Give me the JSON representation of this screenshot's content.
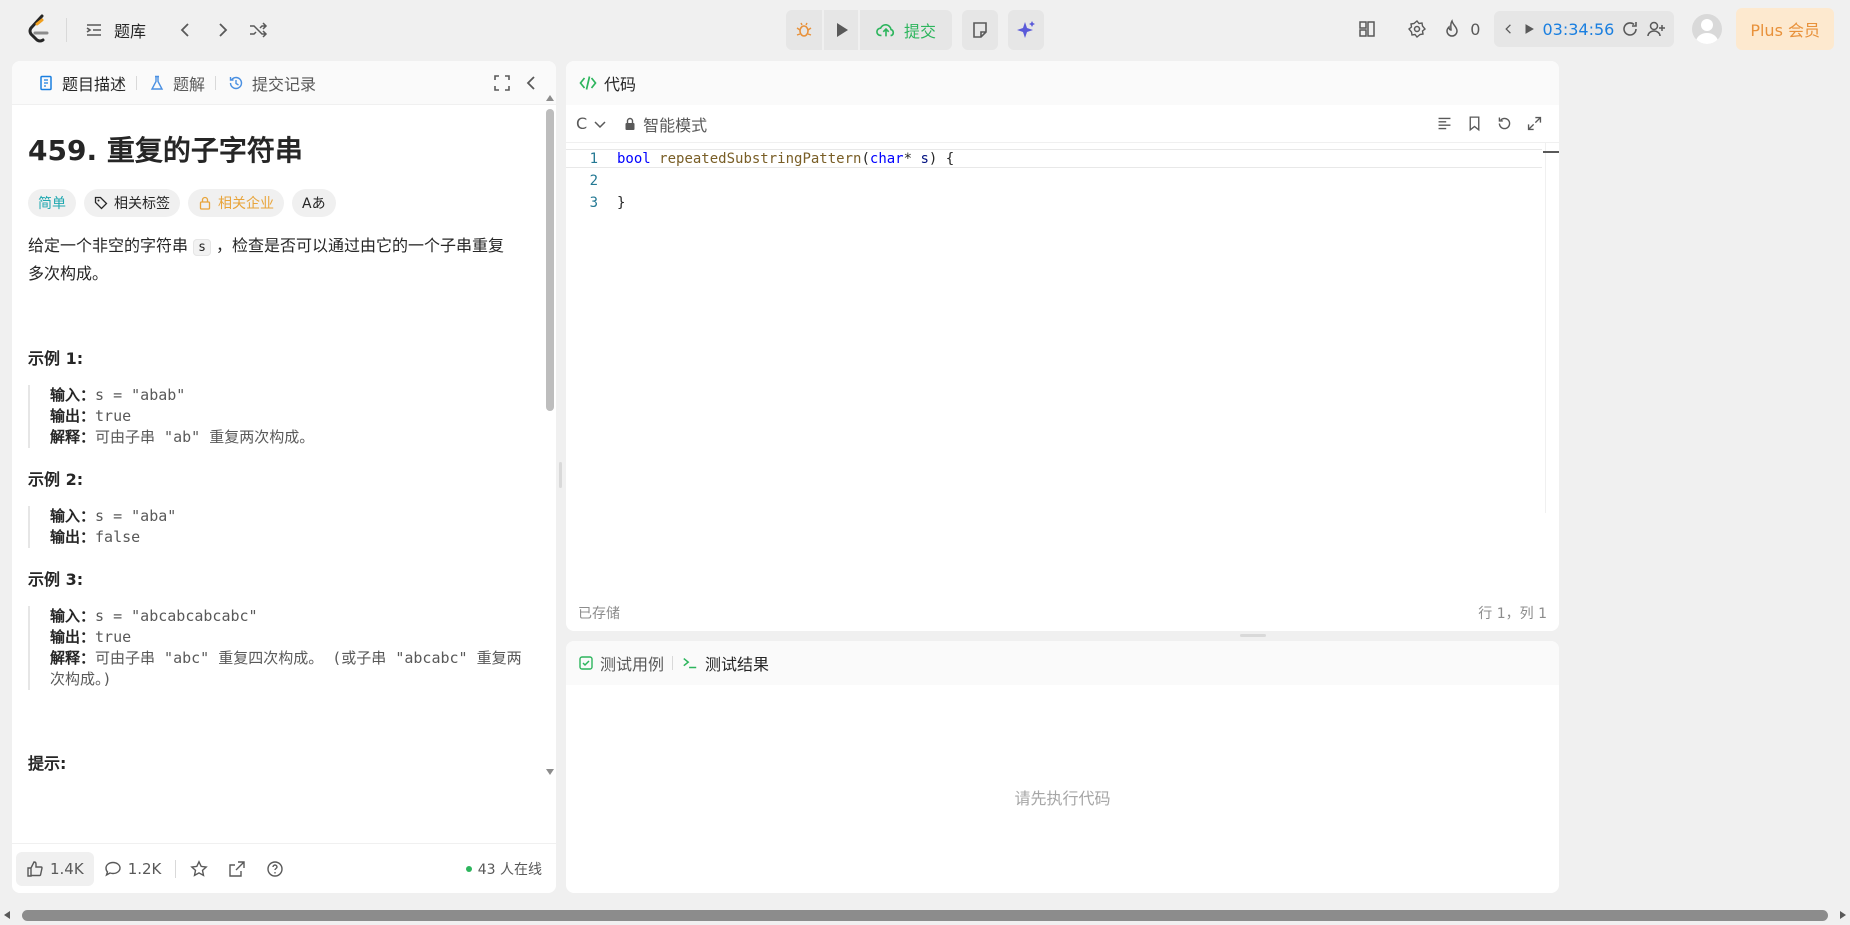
{
  "topbar": {
    "problemset_label": "题库",
    "submit_label": "提交",
    "fire_count": "0",
    "timer": "03:34:56",
    "plus_label": "Plus 会员"
  },
  "left_tabs": [
    {
      "label": "题目描述"
    },
    {
      "label": "题解"
    },
    {
      "label": "提交记录"
    }
  ],
  "problem": {
    "title": "459. 重复的子字符串",
    "tags": {
      "difficulty": "简单",
      "related_tags": "相关标签",
      "related_companies": "相关企业",
      "translate_icon": "Aあ"
    },
    "intro_before": "给定一个非空的字符串 ",
    "intro_code": "s",
    "intro_after": " ，检查是否可以通过由它的一个子串重复多次构成。",
    "examples": [
      {
        "title": "示例 1:",
        "input_label": "输入：",
        "input": "s = \"abab\"",
        "output_label": "输出：",
        "output": "true",
        "explain_label": "解释：",
        "explain": "可由子串 \"ab\" 重复两次构成。"
      },
      {
        "title": "示例 2:",
        "input_label": "输入：",
        "input": "s = \"aba\"",
        "output_label": "输出：",
        "output": "false"
      },
      {
        "title": "示例 3:",
        "input_label": "输入：",
        "input": "s = \"abcabcabcabc\"",
        "output_label": "输出：",
        "output": "true",
        "explain_label": "解释：",
        "explain": "可由子串 \"abc\" 重复四次构成。 (或子串 \"abcabc\" 重复两次构成。)"
      }
    ],
    "hint_title": "提示:"
  },
  "left_footer": {
    "likes": "1.4K",
    "comments": "1.2K",
    "online": "43 人在线"
  },
  "code_panel": {
    "title": "代码",
    "language": "C",
    "mode": "智能模式",
    "lines": [
      {
        "num": "1"
      },
      {
        "num": "2"
      },
      {
        "num": "3",
        "text": "}"
      }
    ],
    "line1": {
      "kw1": "bool",
      "fn": "repeatedSubstringPattern",
      "p1": "(",
      "kw2": "char",
      "p2": "* ",
      "param": "s",
      "p3": ") {"
    },
    "status_saved": "已存储",
    "cursor": "行 1，列 1"
  },
  "test_panel": {
    "tab_cases": "测试用例",
    "tab_results": "测试结果",
    "empty": "请先执行代码"
  },
  "colors": {
    "accent_green": "#2db55d",
    "timer_blue": "#1a7fe0",
    "plus_orange": "#e8913a",
    "easy_teal": "#20a8b0"
  }
}
